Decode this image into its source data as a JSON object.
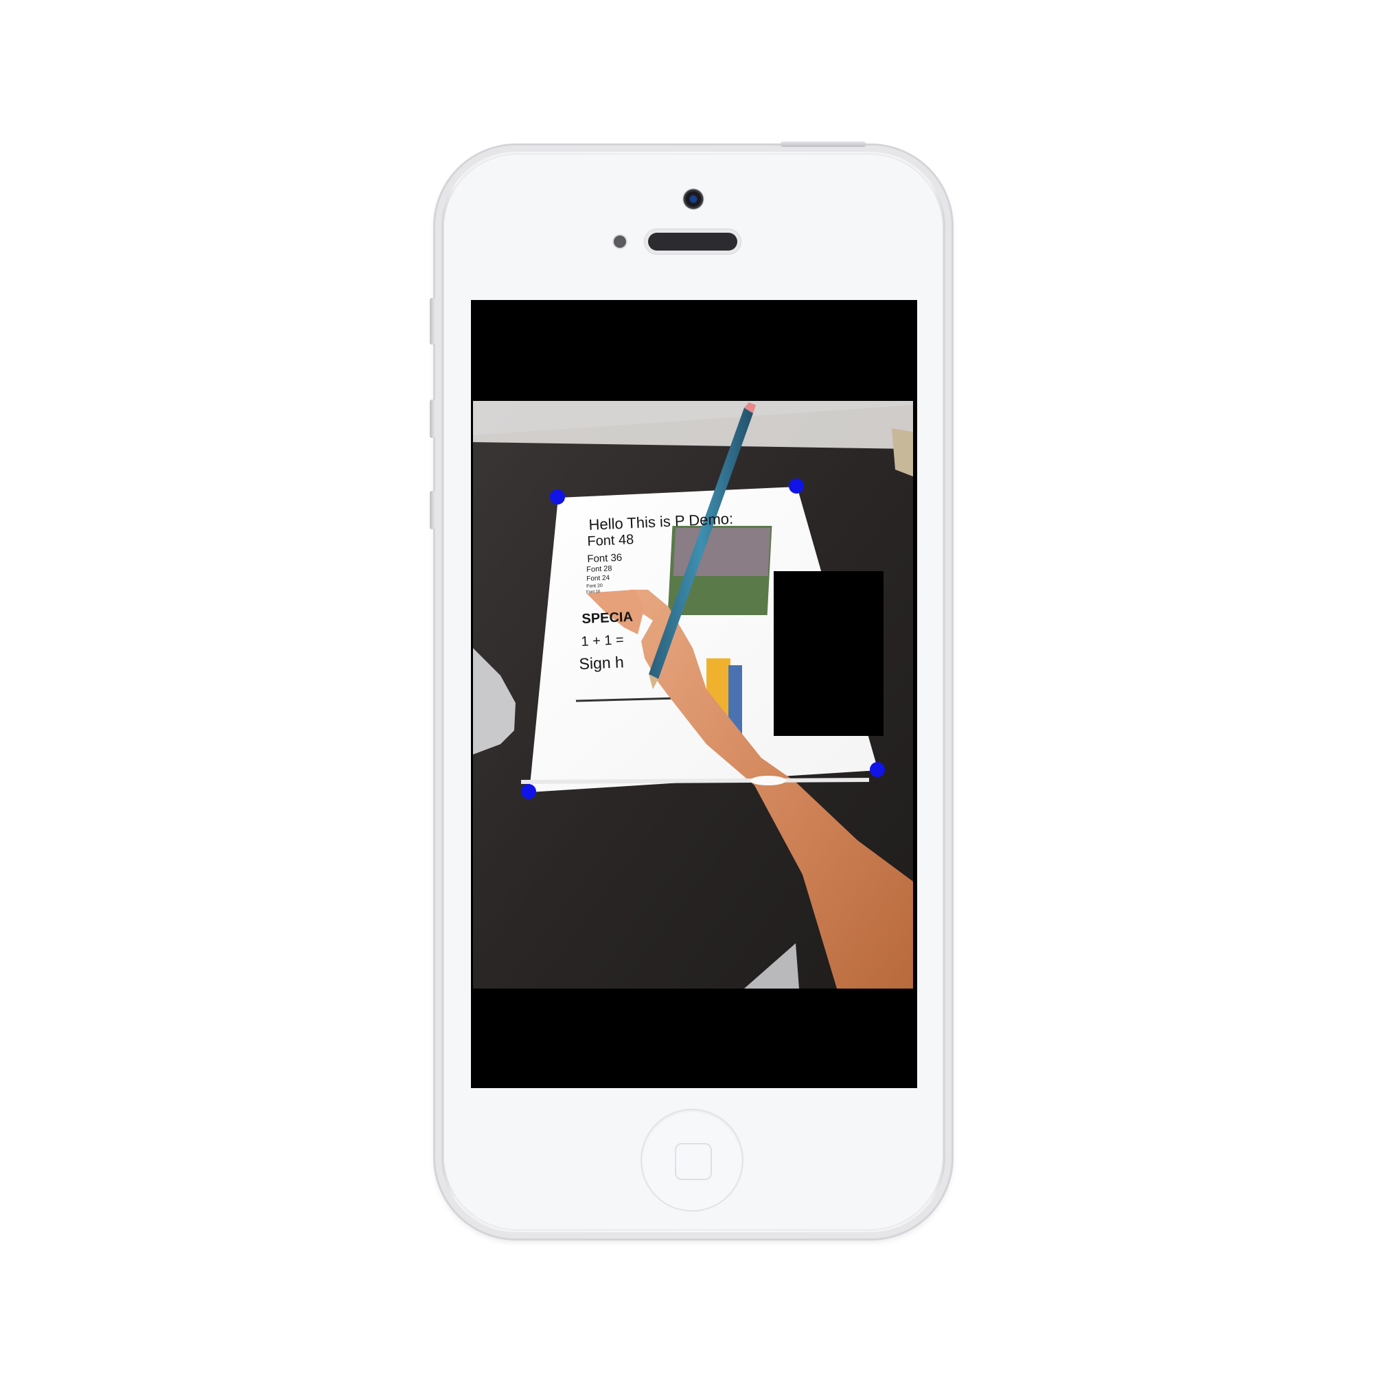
{
  "device": {
    "model": "white smartphone",
    "icons": [
      "front-camera-icon",
      "speaker-grille-icon",
      "home-button-icon"
    ]
  },
  "document": {
    "title_line": "Hello This is P  Demo:",
    "lines": [
      "Font 48",
      "Font 36",
      "Font 28",
      "Font 24",
      "Font 20",
      "Font 16"
    ],
    "special": "SPECIA",
    "equation": "1 + 1 =",
    "sign": "Sign h"
  },
  "overlay": {
    "corner_color": "#1014e6",
    "redaction_color": "#000000"
  }
}
